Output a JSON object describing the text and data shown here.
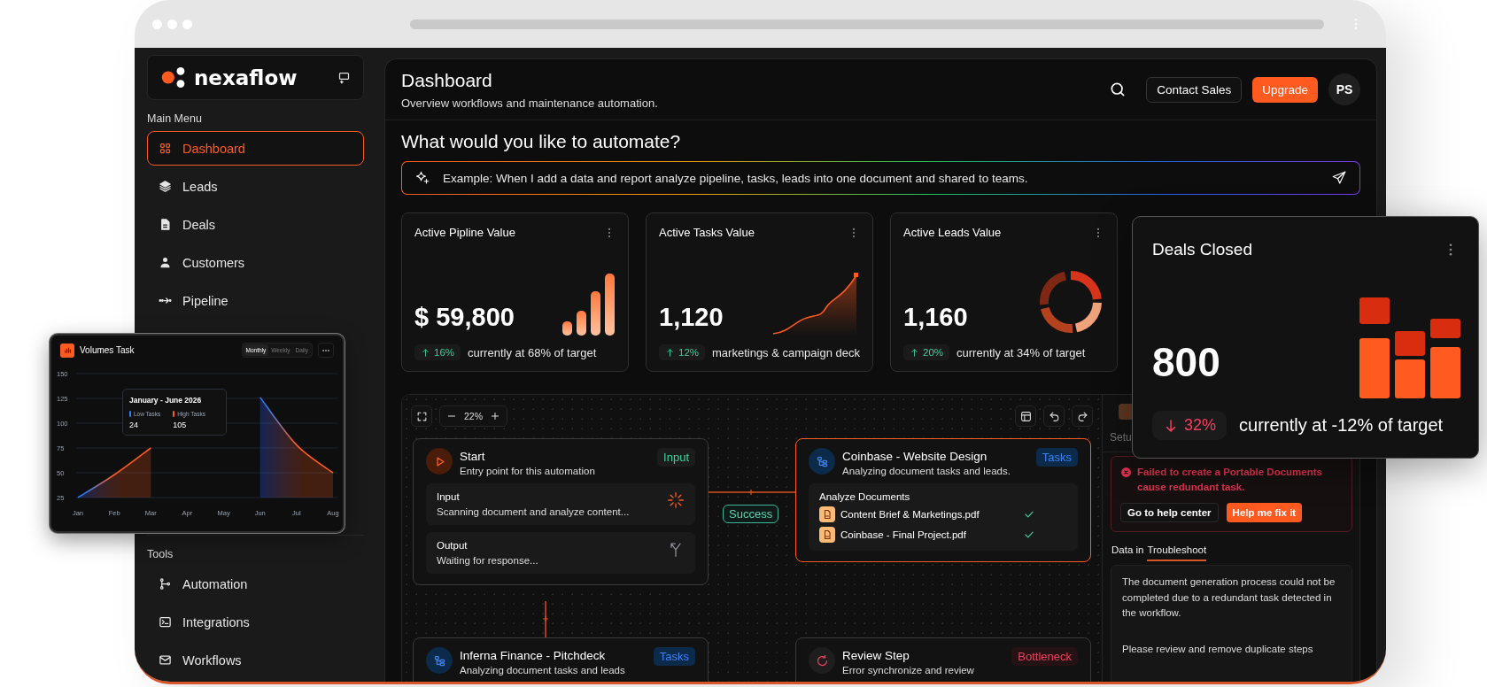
{
  "sidebar": {
    "logo": "nexaflow",
    "sections": [
      {
        "title": "Main Menu",
        "items": [
          {
            "label": "Dashboard",
            "selected": true
          },
          {
            "label": "Leads",
            "selected": false
          },
          {
            "label": "Deals",
            "selected": false
          },
          {
            "label": "Customers",
            "selected": false
          },
          {
            "label": "Pipeline",
            "selected": false
          }
        ]
      },
      {
        "title": "Tools",
        "items": [
          {
            "label": "Automation",
            "selected": false
          },
          {
            "label": "Integrations",
            "selected": false
          },
          {
            "label": "Workflows",
            "selected": false
          }
        ]
      }
    ]
  },
  "header": {
    "title": "Dashboard",
    "subtitle": "Overview workflows and maintenance automation.",
    "buttons": [
      {
        "label": "Contact Sales",
        "kind": "outline"
      },
      {
        "label": "Upgrade",
        "kind": "primary"
      }
    ],
    "avatar": "PS"
  },
  "prompt": {
    "heading": "What would you like to automate?",
    "placeholder": "Example: When I add a data and report analyze pipeline, tasks, leads into one document and shared to teams."
  },
  "metrics": [
    {
      "title": "Active Pipline Value",
      "value": "$ 59,800",
      "kind": "bars",
      "down": false,
      "change": "16%",
      "note": "currently at 68% of target"
    },
    {
      "title": "Active Tasks Value",
      "value": "1,120",
      "kind": "area",
      "down": false,
      "change": "12%",
      "note": "marketings & campaign deck"
    },
    {
      "title": "Active Leads Value",
      "value": "1,160",
      "kind": "donut",
      "down": false,
      "change": "20%",
      "note": "currently at 34% of target"
    }
  ],
  "deals_card": {
    "title": "Deals Closed",
    "value": "800",
    "down": true,
    "change": "32%",
    "note": "currently at -12% of target"
  },
  "volumes": {
    "title": "Volumes Task",
    "periods": [
      {
        "label": "Monthly",
        "selected": true
      },
      {
        "label": "Weekly",
        "selected": false
      },
      {
        "label": "Daily",
        "selected": false
      }
    ],
    "tooltip": {
      "title": "January - June 2026",
      "items": [
        {
          "label": "Low Tasks",
          "value": "24",
          "color": "#2f7bf0"
        },
        {
          "label": "High Tasks",
          "value": "105",
          "color": "#ff5a1f"
        }
      ]
    },
    "chart_data": {
      "type": "area",
      "grid": true,
      "categories": [
        "Jan",
        "Feb",
        "Mar",
        "Apr",
        "May",
        "Jun",
        "Jul",
        "Aug"
      ],
      "ylim": [
        25,
        150
      ],
      "yticks": [
        25,
        50,
        75,
        100,
        125,
        150
      ],
      "series": [
        {
          "color": "#ff5a1f",
          "values": [
            25,
            48,
            75,
            null,
            null,
            126,
            78,
            50
          ]
        }
      ]
    }
  },
  "canvas": {
    "zoom": "22%",
    "connector_label": "Success",
    "nodes": [
      {
        "kind": "start",
        "title": "Start",
        "subtitle": "Entry point for this automation",
        "tag": {
          "label": "Input",
          "kind": "input"
        },
        "selected": false,
        "steps": [
          {
            "title": "Input",
            "text": "Scanning document and analyze content...",
            "kind": "loading"
          },
          {
            "title": "Output",
            "text": "Waiting for response...",
            "kind": "branch"
          }
        ]
      },
      {
        "kind": "task",
        "title": "Coinbase - Website Design",
        "subtitle": "Analyzing document tasks and leads.",
        "tag": {
          "label": "Tasks",
          "kind": "tasks"
        },
        "selected": true,
        "section": {
          "title": "Analyze Documents",
          "files": [
            {
              "name": "Content Brief & Marketings.pdf",
              "done": true
            },
            {
              "name": "Coinbase - Final Project.pdf",
              "done": true
            }
          ]
        }
      },
      {
        "kind": "task",
        "title": "Inferna Finance - Pitchdeck",
        "subtitle": "Analyzing document tasks and leads",
        "tag": {
          "label": "Tasks",
          "kind": "tasks"
        },
        "selected": false
      },
      {
        "kind": "review",
        "title": "Review Step",
        "subtitle": "Error synchronize and review",
        "tag": {
          "label": "Bottleneck",
          "kind": "bottleneck"
        },
        "selected": false
      }
    ]
  },
  "side_panel": {
    "tab_fragment": "Setu",
    "error": {
      "message": "Failed to create a Portable Documents cause redundant task.",
      "buttons": [
        {
          "label": "Go to help center",
          "kind": "outline"
        },
        {
          "label": "Help me fix it",
          "kind": "primary"
        }
      ]
    },
    "tabs": [
      {
        "label": "Data in",
        "selected": false
      },
      {
        "label": "Troubleshoot",
        "selected": true
      }
    ],
    "paragraphs": [
      "The document generation process could not be completed due to a redundant task detected in the workflow.",
      "Please review and remove duplicate steps"
    ]
  }
}
